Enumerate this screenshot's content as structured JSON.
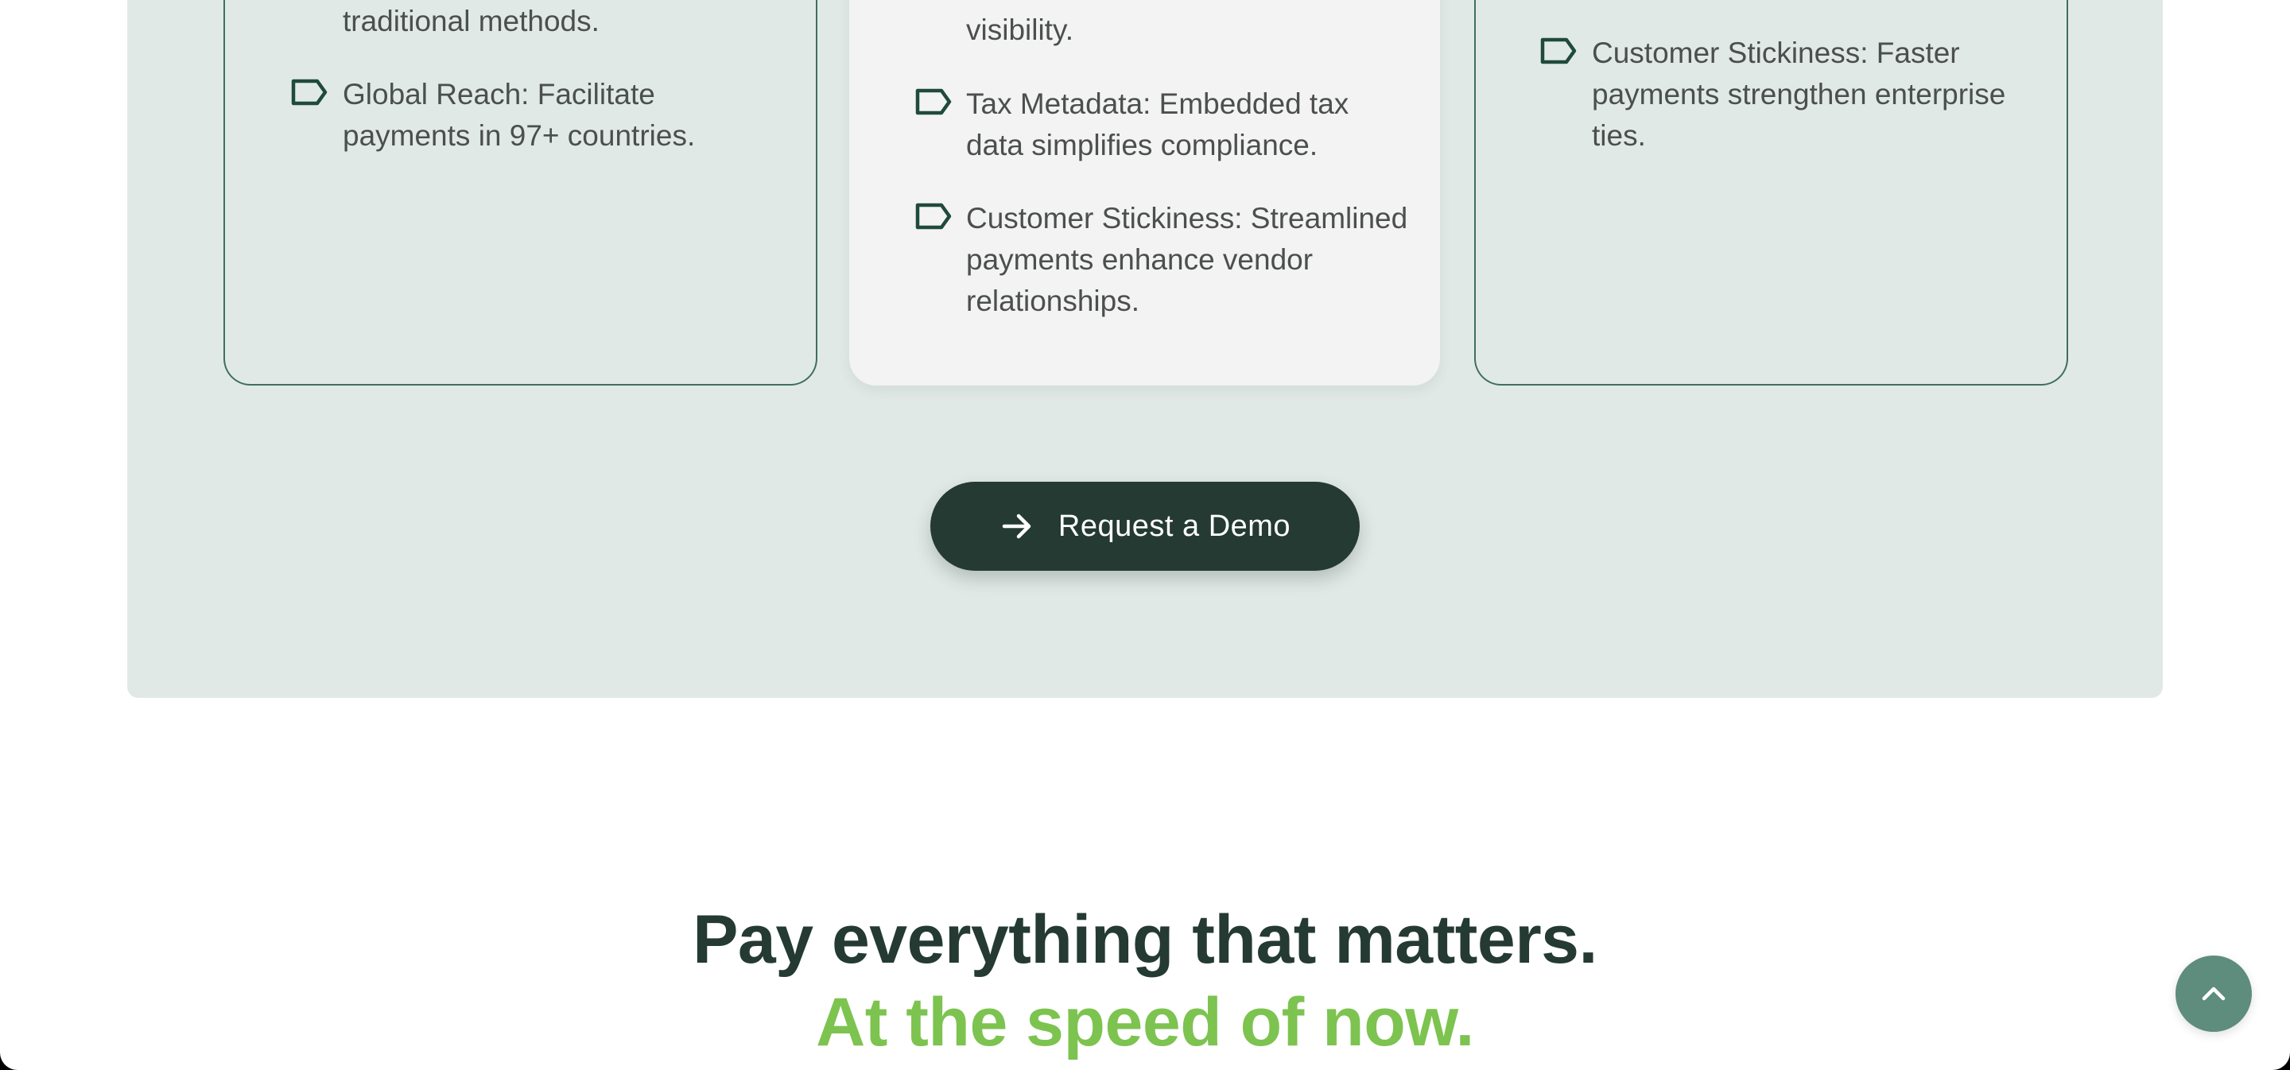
{
  "colors": {
    "panel_bg": "#e1e9e6",
    "card_border": "#3f6f5e",
    "card_filled_bg": "#f3f3f3",
    "button_bg": "#243a33",
    "heading_dark": "#243a33",
    "heading_green": "#7dc350",
    "scroll_top_bg": "#5e8c7d"
  },
  "cards": [
    {
      "style": "outlined",
      "items": [
        {
          "icon": "tag-icon",
          "text": "traditional methods."
        },
        {
          "icon": "tag-icon",
          "text": "Global Reach: Facilitate payments in 97+ countries."
        }
      ]
    },
    {
      "style": "filled",
      "items": [
        {
          "icon": "tag-icon",
          "text": "visibility."
        },
        {
          "icon": "tag-icon",
          "text": "Tax Metadata: Embedded tax data simplifies compliance."
        },
        {
          "icon": "tag-icon",
          "text": "Customer Stickiness: Streamlined payments enhance vendor relationships."
        }
      ]
    },
    {
      "style": "outlined",
      "items": [
        {
          "icon": "tag-icon",
          "text": "Customer Stickiness: Faster payments strengthen enterprise ties."
        }
      ]
    }
  ],
  "cta": {
    "label": "Request a Demo",
    "icon": "arrow-right-icon"
  },
  "headline": {
    "line1": "Pay everything that matters.",
    "line2": "At the speed of now."
  },
  "scroll_top": {
    "icon": "chevron-up-icon"
  }
}
